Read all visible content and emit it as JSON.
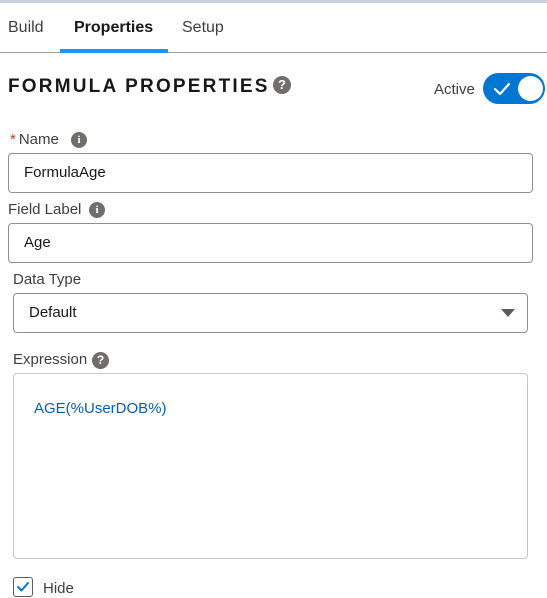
{
  "tabs": [
    {
      "label": "Build"
    },
    {
      "label": "Properties",
      "active": true
    },
    {
      "label": "Setup"
    }
  ],
  "header": {
    "title": "FORMULA PROPERTIES",
    "help_icon": "help-icon",
    "active_label": "Active",
    "active_on": true
  },
  "fields": {
    "name": {
      "required_mark": "*",
      "label": "Name",
      "value": "FormulaAge"
    },
    "field_label": {
      "label": "Field Label",
      "value": "Age"
    },
    "data_type": {
      "label": "Data Type",
      "selected": "Default"
    },
    "expression": {
      "label": "Expression",
      "value": "AGE(%UserDOB%)"
    },
    "hide": {
      "label": "Hide",
      "checked": true
    }
  },
  "colors": {
    "accent": "#0176d3",
    "tab_underline": "#1b96ff",
    "expression_text": "#0b5cab",
    "required": "#c23934"
  }
}
